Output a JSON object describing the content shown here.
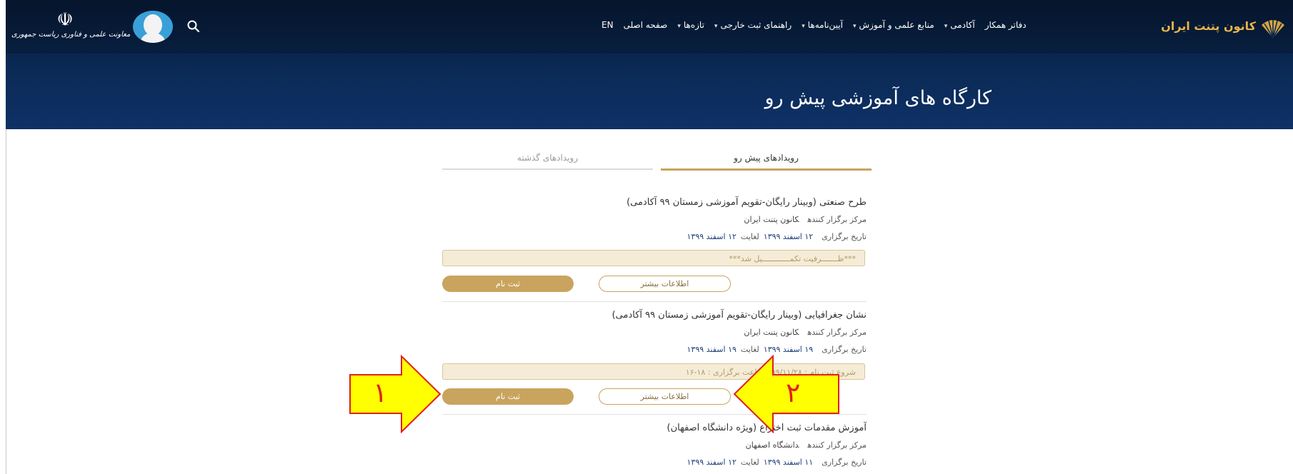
{
  "header": {
    "gov_logo_caption": "معاونت علمی و فناوری ریاست جمهوری",
    "brand_name": "کانون پتنت ایران",
    "page_title": "کارگاه های آموزشی پیش رو",
    "nav": [
      {
        "label": "EN",
        "dropdown": false
      },
      {
        "label": "صفحه اصلی",
        "dropdown": false
      },
      {
        "label": "تازه‌ها",
        "dropdown": true
      },
      {
        "label": "راهنمای ثبت خارجی",
        "dropdown": true
      },
      {
        "label": "آیین‌نامه‌ها",
        "dropdown": true
      },
      {
        "label": "منابع علمی و آموزش",
        "dropdown": true
      },
      {
        "label": "آکادمی",
        "dropdown": true
      },
      {
        "label": "دفاتر همکار",
        "dropdown": false
      }
    ],
    "colors": {
      "bg": "#0b2a56",
      "brand": "#e8b54a"
    }
  },
  "tabs": {
    "active": "رویدادهای پیش رو",
    "inactive": "رویدادهای گذشته"
  },
  "labels": {
    "organizer": "مرکز برگزار کننده",
    "date": "تاریخ برگزاری",
    "until": "لغایت",
    "register": "ثبت نام",
    "more_info": "اطلاعات بیشتر"
  },
  "events": [
    {
      "title": "طرح صنعتی (وبینار رایگان-تقویم آموزشی زمستان ۹۹ آکادمی)",
      "organizer": "کانون پتنت ایران",
      "date_from": "۱۲ اسفند ۱۳۹۹",
      "date_to": "۱۲ اسفند ۱۳۹۹",
      "notice": "***ظـــــــرفیت تکمــــــــــــیل شد***"
    },
    {
      "title": "نشان جغرافیایی (وبینار رایگان-تقویم آموزشی زمستان ۹۹ آکادمی)",
      "organizer": "کانون پتنت ایران",
      "date_from": "۱۹ اسفند ۱۳۹۹",
      "date_to": "۱۹ اسفند ۱۳۹۹",
      "notice": "شروع ثبت نام : ۹۹/۱۱/۲۸ - ساعت برگزاری : ۱۸-۱۶"
    },
    {
      "title": "آموزش مقدمات ثبت اختراع (ویژه دانشگاه اصفهان)",
      "organizer": "دانشگاه اصفهان",
      "date_from": "۱۱ اسفند ۱۳۹۹",
      "date_to": "۱۲ اسفند ۱۳۹۹"
    }
  ],
  "annotations": {
    "arrow1": "۱",
    "arrow2": "۲"
  }
}
